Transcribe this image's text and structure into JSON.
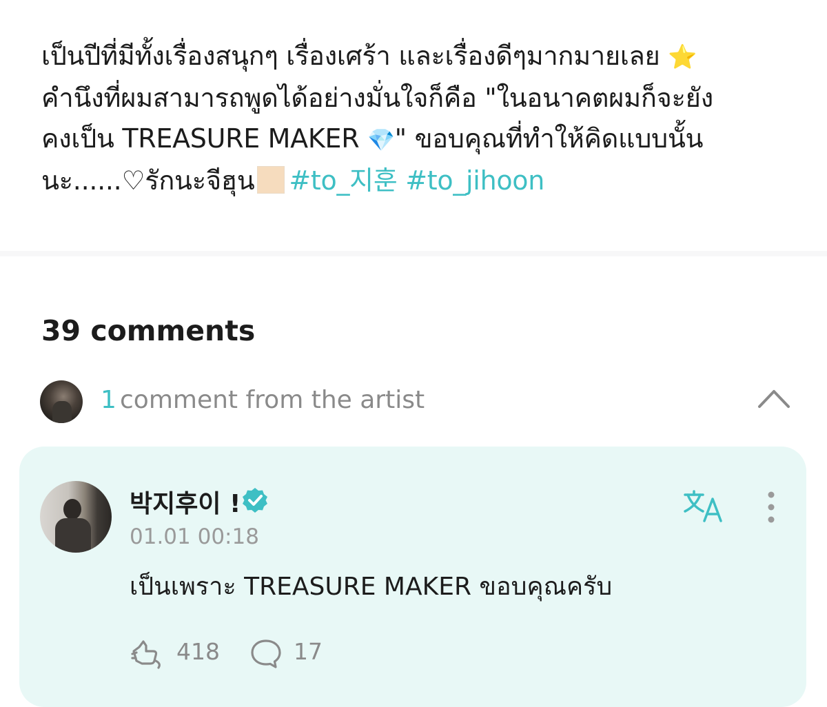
{
  "post": {
    "lines": [
      "เป็นปีที่มีทั้งเรื่องสนุกๆ เรื่องเศร้า และเรื่องดีๆมากมายเลย",
      "คำนึงที่ผมสามารถพูดได้อย่างมั่นใจก็คือ \"ในอนาคตผมก็จะยัง",
      "คงเป็น TREASURE MAKER",
      "\" ขอบคุณที่ทำให้คิดแบบนั้น",
      "นะ......♡รักนะจีฮุน"
    ],
    "star_emoji": "⭐",
    "gem_emoji": "💎",
    "hashtags": [
      "#to_지훈",
      "#to_jihoon"
    ]
  },
  "comments": {
    "heading": "39 comments",
    "artist_count": "1",
    "artist_label": "comment from the artist"
  },
  "artist_comment": {
    "author": "박지후이 !",
    "timestamp": "01.01 00:18",
    "body": "เป็นเพราะ TREASURE MAKER ขอบคุณครับ",
    "reactions": "418",
    "replies": "17"
  },
  "colors": {
    "accent": "#3ebfc4",
    "card_background": "#e8f8f6",
    "muted_text": "#8a8a8a"
  },
  "icons": {
    "collapse": "chevron-up-icon",
    "verified": "verified-badge-icon",
    "translate": "translate-icon",
    "more": "more-vertical-icon",
    "reaction": "reaction-icon",
    "reply": "reply-bubble-icon"
  }
}
